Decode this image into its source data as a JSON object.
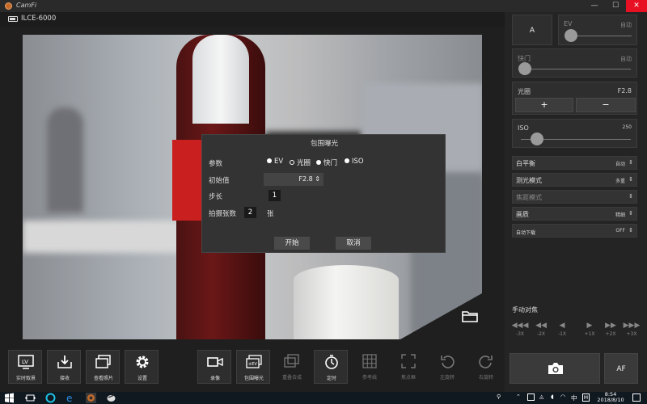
{
  "app": {
    "title": "CamFi"
  },
  "window_controls": {
    "minimize": "—",
    "maximize": "☐",
    "close": "✕"
  },
  "device": {
    "name": "ILCE-6000"
  },
  "dialog": {
    "title": "包围曝光",
    "param_label": "参数",
    "params": [
      "EV",
      "光圈",
      "快门",
      "ISO"
    ],
    "selected_param": "EV",
    "start_label": "初始值",
    "start_value": "F2.8",
    "step_label": "步长",
    "step_value": "1",
    "count_label": "拍摄张数",
    "count_value": "2",
    "count_unit": "张",
    "start_button": "开始",
    "cancel_button": "取消"
  },
  "right_panel": {
    "mode_button": "A",
    "ev": {
      "label": "EV",
      "auto": "自动",
      "level": 0
    },
    "shutter": {
      "label": "快门",
      "auto": "自动",
      "level": 0
    },
    "aperture": {
      "label": "光圈",
      "value": "F2.8",
      "plus": "+",
      "minus": "−"
    },
    "iso": {
      "label": "ISO",
      "value": "250",
      "level": 0.1
    },
    "menus": [
      {
        "label": "白平衡",
        "value": "自动",
        "enabled": true
      },
      {
        "label": "测光模式",
        "value": "多重",
        "enabled": true
      },
      {
        "label": "焦距模式",
        "value": "",
        "enabled": false
      },
      {
        "label": "画质",
        "value": "精细",
        "enabled": true
      },
      {
        "label": "自动下载",
        "value": "OFF",
        "enabled": true
      }
    ],
    "manual_focus": {
      "title": "手动对焦",
      "buttons": [
        {
          "glyph": "◀◀◀",
          "label": "-3X"
        },
        {
          "glyph": "◀◀",
          "label": "-2X"
        },
        {
          "glyph": "◀",
          "label": "-1X"
        },
        {
          "glyph": "▶",
          "label": "+1X"
        },
        {
          "glyph": "▶▶",
          "label": "+2X"
        },
        {
          "glyph": "▶▶▶",
          "label": "+3X"
        }
      ]
    },
    "af_button": "AF"
  },
  "toolbar": [
    {
      "label": "实时取景",
      "icon": "liveview-icon",
      "enabled": true
    },
    {
      "label": "接收",
      "icon": "download-icon",
      "enabled": true
    },
    {
      "label": "查看照片",
      "icon": "photos-icon",
      "enabled": true
    },
    {
      "label": "设置",
      "icon": "gear-icon",
      "enabled": true
    },
    {
      "label": "录像",
      "icon": "video-icon",
      "enabled": true
    },
    {
      "label": "包围曝光",
      "icon": "bracketing-icon",
      "enabled": true
    },
    {
      "label": "重叠合成",
      "icon": "overlay-icon",
      "enabled": false
    },
    {
      "label": "定时",
      "icon": "timer-icon",
      "enabled": true
    },
    {
      "label": "参考线",
      "icon": "grid-icon",
      "enabled": false
    },
    {
      "label": "焦点框",
      "icon": "focus-frame-icon",
      "enabled": false
    },
    {
      "label": "左旋转",
      "icon": "rotate-left-icon",
      "enabled": false
    },
    {
      "label": "右旋转",
      "icon": "rotate-right-icon",
      "enabled": false
    }
  ],
  "taskbar": {
    "ime": "中",
    "time": "8:54",
    "date": "2018/8/10"
  }
}
